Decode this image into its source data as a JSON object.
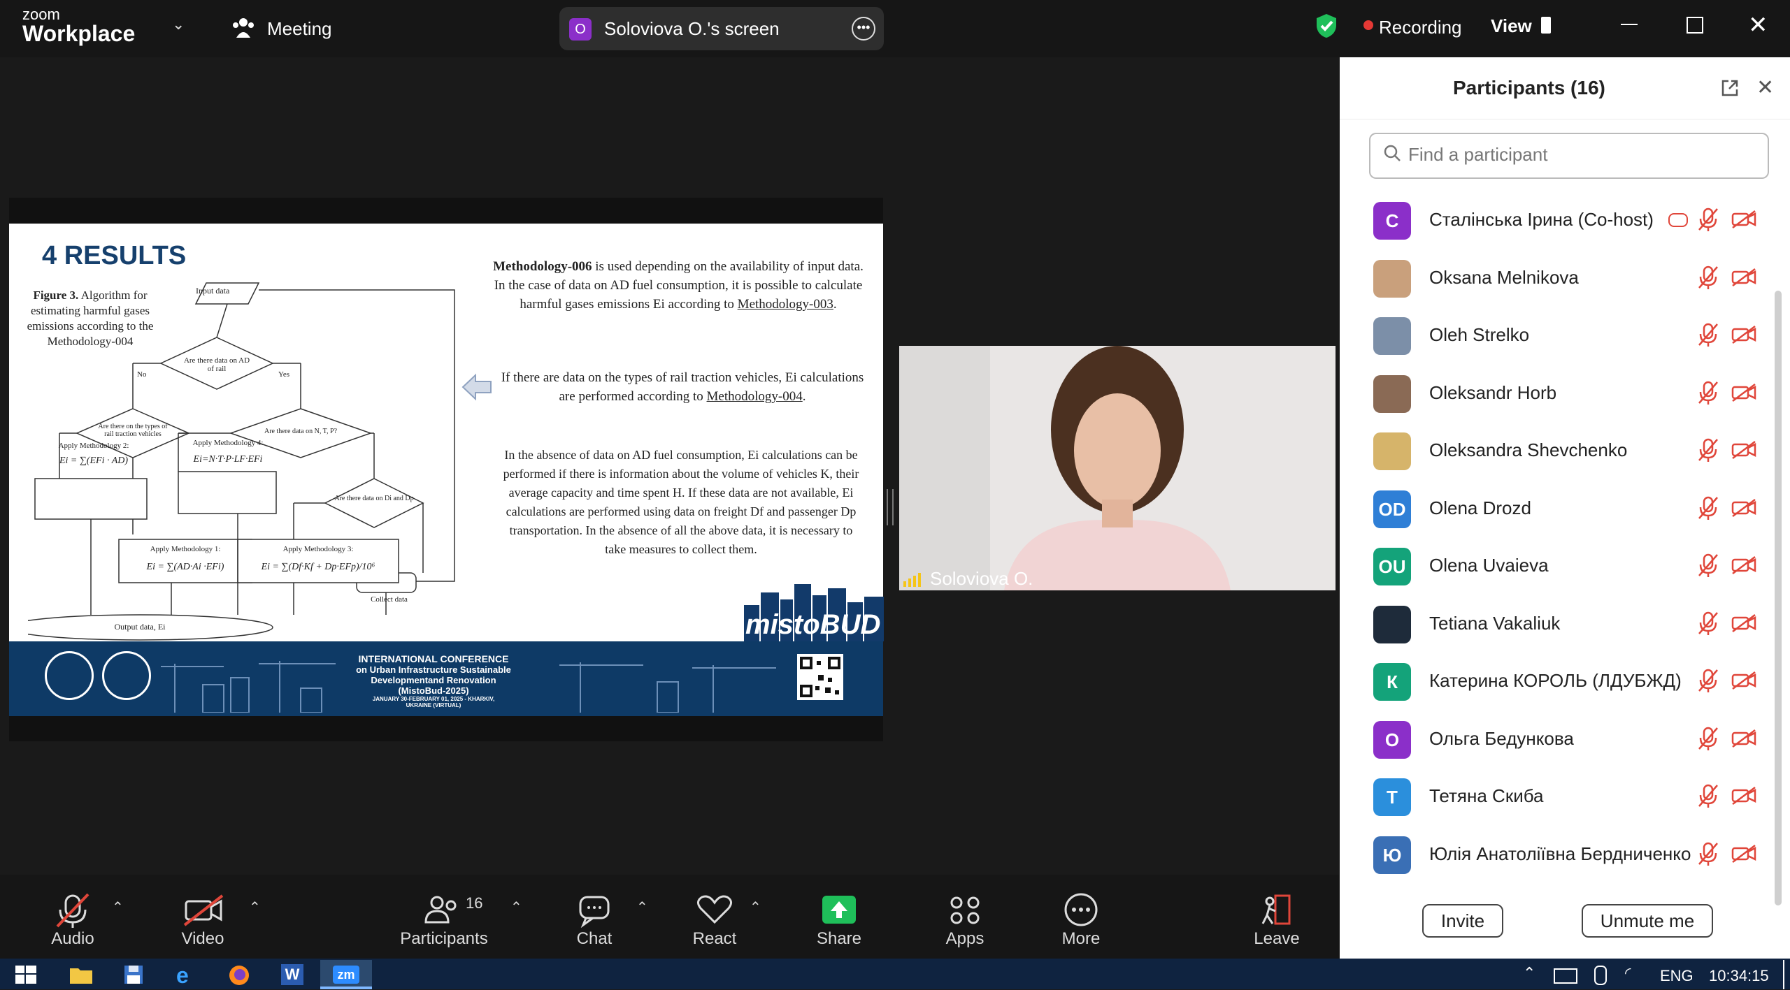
{
  "titlebar": {
    "logo_small": "zoom",
    "logo_big": "Workplace",
    "meeting_label": "Meeting",
    "share_avatar": "O",
    "share_label": "Soloviova O.'s screen",
    "recording_label": "Recording",
    "view_label": "View"
  },
  "slide": {
    "title": "4 RESULTS",
    "figure_caption_bold": "Figure 3.",
    "figure_caption": "Algorithm for estimating harmful gases emissions according to the Methodology-004",
    "flow": {
      "input": "Input data",
      "d1": "Are there data on AD of rail",
      "d2": "Are there on the types of rail traction vehicles",
      "d3": "Are there data on N, T, P?",
      "d4": "Are there data on Di and Dp",
      "m2_title": "Apply Methodology 2:",
      "m2_formula": "Ei = ∑(EFi · AD)",
      "m4_title": "Apply Methodology 4:",
      "m4_formula": "Ei=N·T·P·LF·EFi",
      "m1_title": "Apply Methodology 1:",
      "m1_formula": "Ei = ∑(AD·Ai ·EFi)",
      "m3_title": "Apply Methodology 3:",
      "m3_formula": "Ei = ∑(Df·Kf + Dp·EFp)/10⁶",
      "collect": "Collect data",
      "output": "Output data, Ei",
      "yes": "Yes",
      "no": "No"
    },
    "para1_bold": "Methodology-006",
    "para1": "is used depending on the availability of input data. In the case of data on AD fuel consumption, it is possible to calculate harmful gases emissions Ei according to",
    "para1_link": "Methodology-003",
    "para2": "If there are data on the types of rail traction vehicles, Ei calculations are performed according to",
    "para2_link": "Methodology-004",
    "para3": "In the absence of data on AD fuel consumption, Ei calculations can be performed if there is information about the volume of vehicles K, their average capacity and time spent H. If these data are not available, Ei calculations are performed using data on freight Df and passenger Dp transportation. In the absence of all the above data, it is necessary to take measures to collect them.",
    "brand": "mistoBUD",
    "conf_line1": "INTERNATIONAL CONFERENCE",
    "conf_line2": "on Urban Infrastructure Sustainable",
    "conf_line3": "Developmentand Renovation",
    "conf_line4": "(MistoBud-2025)",
    "conf_line5": "JANUARY 30-FEBRUARY 01, 2025 - KHARKIV,",
    "conf_line6": "UKRAINE (VIRTUAL)"
  },
  "speaker": {
    "name": "Soloviova O."
  },
  "panel": {
    "title": "Participants (16)",
    "search_placeholder": "Find a participant",
    "invite_label": "Invite",
    "unmute_label": "Unmute me",
    "participants": [
      {
        "initials": "С",
        "name": "Сталінська Ірина (Co-host)",
        "color": "#8b2fc9"
      },
      {
        "initials": "",
        "name": "Oksana Melnikova",
        "color": "#c9a07c"
      },
      {
        "initials": "",
        "name": "Oleh Strelko",
        "color": "#7c8fa8"
      },
      {
        "initials": "",
        "name": "Oleksandr Horb",
        "color": "#8a6a55"
      },
      {
        "initials": "",
        "name": "Oleksandra Shevchenko",
        "color": "#d6b46a"
      },
      {
        "initials": "OD",
        "name": "Olena Drozd",
        "color": "#2f7fd6"
      },
      {
        "initials": "OU",
        "name": "Olena Uvaieva",
        "color": "#14a37a"
      },
      {
        "initials": "",
        "name": "Tetiana Vakaliuk",
        "color": "#1e2b3a"
      },
      {
        "initials": "К",
        "name": "Катерина КОРОЛЬ (ЛДУБЖД)",
        "color": "#14a37a"
      },
      {
        "initials": "О",
        "name": "Ольга Бедункова",
        "color": "#8b2fc9"
      },
      {
        "initials": "Т",
        "name": "Тетяна Скиба",
        "color": "#2b8fdc"
      },
      {
        "initials": "Ю",
        "name": "Юлія Анатоліївна Бердниченко",
        "color": "#3a6fb5"
      }
    ]
  },
  "toolbar": {
    "audio": "Audio",
    "video": "Video",
    "participants": "Participants",
    "participants_count": "16",
    "chat": "Chat",
    "react": "React",
    "share": "Share",
    "apps": "Apps",
    "more": "More",
    "leave": "Leave"
  },
  "taskbar": {
    "lang": "ENG",
    "time": "10:34:15",
    "zm": "zm"
  },
  "colors": {
    "accent_green": "#1fbf5a",
    "recording_red": "#e53935",
    "slide_navy": "#0e3a66",
    "muted_red": "#e0463a"
  }
}
